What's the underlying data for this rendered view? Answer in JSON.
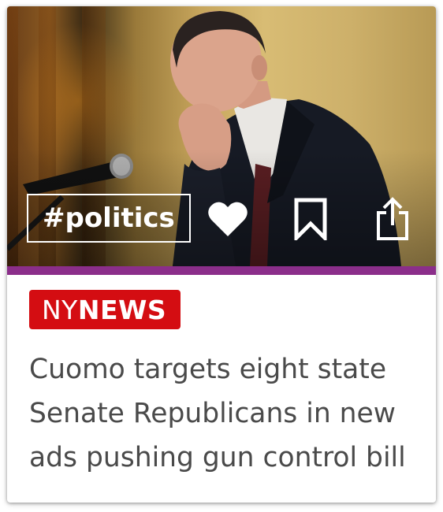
{
  "card": {
    "hashtag": "#politics",
    "source": {
      "prefix": "NY",
      "name": "NEWS",
      "badge_color": "#d40d12"
    },
    "headline": "Cuomo targets eight state Senate Republicans in new ads pushing gun control bill",
    "accent_color": "#8b2e8a",
    "actions": [
      {
        "icon": "heart-icon",
        "filled": true
      },
      {
        "icon": "bookmark-icon",
        "filled": false
      },
      {
        "icon": "share-icon",
        "filled": false
      }
    ]
  }
}
